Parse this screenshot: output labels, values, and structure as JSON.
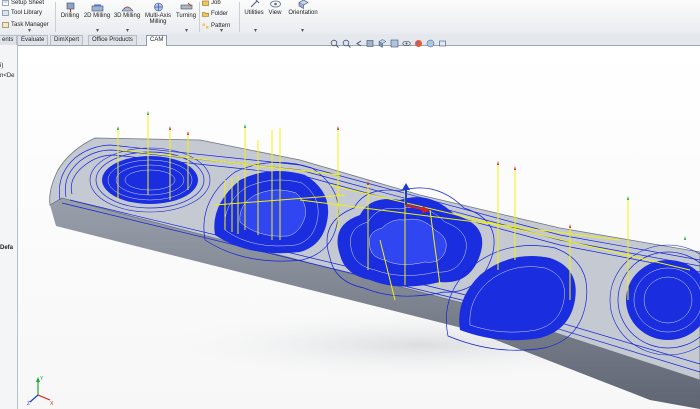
{
  "ribbon": {
    "small_items": [
      {
        "label": "Setup Sheet",
        "icon": "setup-sheet-icon"
      },
      {
        "label": "Tool Library",
        "icon": "tool-library-icon"
      },
      {
        "label": "Task Manager",
        "icon": "task-manager-icon"
      }
    ],
    "buttons": [
      {
        "label": "Drilling",
        "icon": "drilling-icon"
      },
      {
        "label": "2D Milling",
        "icon": "2d-milling-icon"
      },
      {
        "label": "3D Milling",
        "icon": "3d-milling-icon"
      },
      {
        "label": "Multi-Axis",
        "label2": "Milling",
        "icon": "multi-axis-milling-icon"
      },
      {
        "label": "Turning",
        "icon": "turning-icon"
      }
    ],
    "folder_items": [
      {
        "label": "Job",
        "icon": "job-icon"
      },
      {
        "label": "Folder",
        "icon": "folder-icon"
      },
      {
        "label": "Pattern",
        "icon": "pattern-icon"
      }
    ],
    "right_buttons": [
      {
        "label": "Utilities",
        "icon": "utilities-icon"
      },
      {
        "label": "View",
        "icon": "view-icon"
      },
      {
        "label": "Orientation",
        "icon": "orientation-icon"
      }
    ]
  },
  "tabs": [
    {
      "label": "ents",
      "active": false
    },
    {
      "label": "Evaluate",
      "active": false
    },
    {
      "label": "DimXpert",
      "active": false
    },
    {
      "label": "Office Products",
      "active": false
    },
    {
      "label": "CAM",
      "active": true
    }
  ],
  "left_panel": {
    "line1": "i)",
    "line2": "n<De",
    "line3": "Defa"
  },
  "view_toolbar": [
    "zoom-to-fit-icon",
    "zoom-area-icon",
    "previous-view-icon",
    "section-view-icon",
    "view-orientation-icon",
    "display-style-icon",
    "hide-show-icon",
    "edit-appearance-icon",
    "apply-scene-icon",
    "view-settings-icon"
  ],
  "colors": {
    "toolpath": "#1222d8",
    "rapid": "#f2f20a",
    "part": "#b9bec8",
    "part_dark": "#7c8290",
    "arrow_green": "#1aa83a",
    "arrow_red": "#d32020"
  }
}
